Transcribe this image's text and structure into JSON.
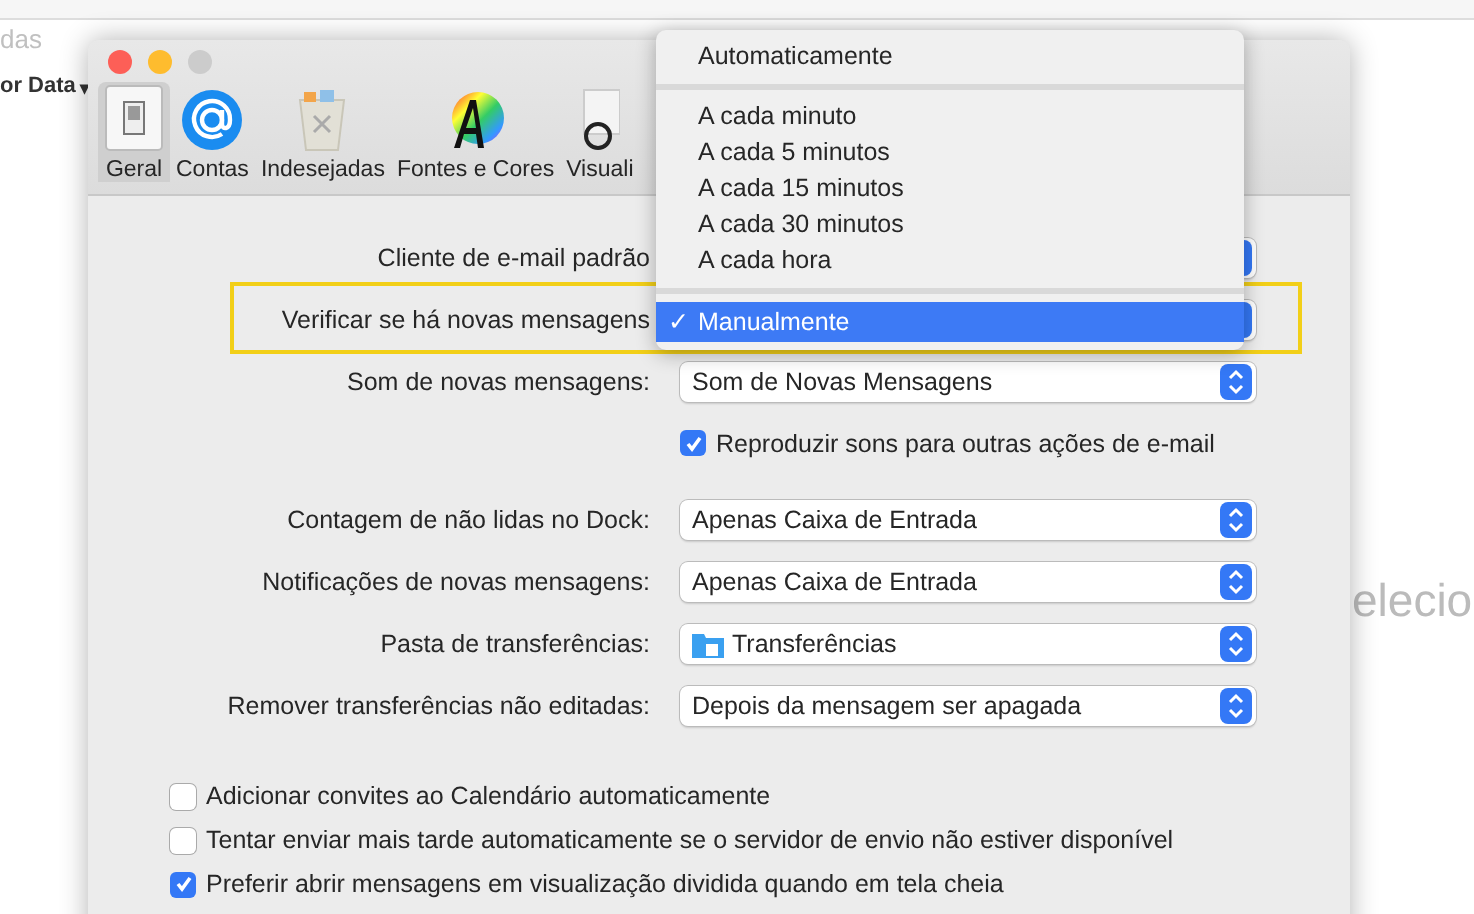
{
  "background_app": {
    "toolbar_label": "das",
    "sort_label": "or Data",
    "sort_caret": "▾",
    "placeholder_text": "elecio"
  },
  "window": {
    "toolbar": [
      {
        "label": "Geral",
        "selected": true
      },
      {
        "label": "Contas",
        "selected": false
      },
      {
        "label": "Indesejadas",
        "selected": false
      },
      {
        "label": "Fontes e Cores",
        "selected": false
      },
      {
        "label": "Visuali",
        "selected": false
      }
    ],
    "settings": [
      {
        "kind": "popup",
        "label": "Cliente de e-mail padrão",
        "highlighted": false
      },
      {
        "kind": "popup",
        "label": "Verificar se há novas mensagens",
        "highlighted": true
      },
      {
        "kind": "popup",
        "label": "Som de novas mensagens:",
        "value": "Som de Novas Mensagens",
        "highlighted": false
      },
      {
        "kind": "checkbox",
        "label": "Reproduzir sons para outras ações de e-mail",
        "checked": true
      },
      {
        "kind": "popup",
        "label": "Contagem de não lidas no Dock:",
        "value": "Apenas Caixa de Entrada",
        "highlighted": false
      },
      {
        "kind": "popup",
        "label": "Notificações de novas mensagens:",
        "value": "Apenas Caixa de Entrada",
        "highlighted": false
      },
      {
        "kind": "popup",
        "label": "Pasta de transferências:",
        "value": "Transferências",
        "folder": true,
        "highlighted": false
      },
      {
        "kind": "popup",
        "label": "Remover transferências não editadas:",
        "value": "Depois da mensagem ser apagada",
        "highlighted": false
      }
    ],
    "options": [
      {
        "label": "Adicionar convites ao Calendário automaticamente",
        "checked": false
      },
      {
        "label": "Tentar enviar mais tarde automaticamente se o servidor de envio não estiver disponível",
        "checked": false
      },
      {
        "label": "Preferir abrir mensagens em visualização dividida quando em tela cheia",
        "checked": true
      }
    ]
  },
  "menu": {
    "items": [
      {
        "kind": "item",
        "label": "Automaticamente",
        "selected": false
      },
      {
        "kind": "separator"
      },
      {
        "kind": "item",
        "label": "A cada minuto",
        "selected": false
      },
      {
        "kind": "item",
        "label": "A cada 5 minutos",
        "selected": false
      },
      {
        "kind": "item",
        "label": "A cada 15 minutos",
        "selected": false
      },
      {
        "kind": "item",
        "label": "A cada 30 minutos",
        "selected": false
      },
      {
        "kind": "item",
        "label": "A cada hora",
        "selected": false
      },
      {
        "kind": "separator"
      },
      {
        "kind": "item",
        "label": "Manualmente",
        "selected": true,
        "check": "✓"
      }
    ]
  }
}
